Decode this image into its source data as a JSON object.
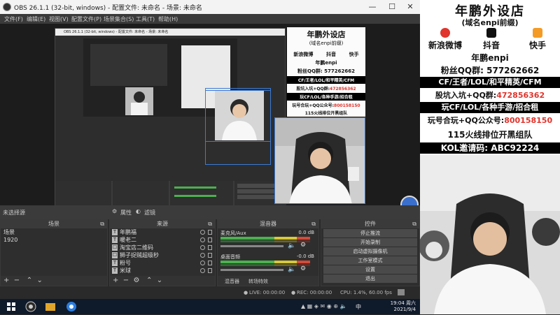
{
  "window": {
    "title": "OBS 26.1.1 (32-bit, windows) - 配置文件: 未命名 - 场景: 未命名",
    "minimize": "—",
    "maximize": "☐",
    "close": "✕"
  },
  "menu": [
    "文件(F)",
    "编辑(E)",
    "视图(V)",
    "配置文件(P)",
    "场景集合(S)",
    "工具(T)",
    "帮助(H)"
  ],
  "nested": {
    "title": "OBS 26.1.1 (32-bit, windows) - 配置文件: 未命名 - 场景: 未命名"
  },
  "info_panel": {
    "title": "年鹏外设店",
    "subtitle": "(域名enpi前缀)",
    "social": [
      "新浪微博",
      "抖音",
      "快手"
    ],
    "author": "年鹏enpi",
    "fans_qq": "粉丝QQ群: 577262662",
    "cf_line": "CF/王者/LOL/和平精英/CFM",
    "group_line_prefix": "股坑入坑+QQ群:",
    "group_num": "472856362",
    "games_line": "玩CF/LOL/各种手游/招合租",
    "wechat_prefix": "玩号合玩+QQ公众号:",
    "wechat_num": "800158150",
    "rank_line": "115火线排位开黑组队",
    "kol_line": "KOL邀请码: ABC92224"
  },
  "context_bar": {
    "no_source": "未选择源",
    "properties": "属性",
    "filters": "滤镜"
  },
  "docks": {
    "scenes": {
      "title": "场景",
      "items": [
        "场景",
        "1920"
      ]
    },
    "sources": {
      "title": "来源",
      "items": [
        {
          "icon": "T",
          "label": "年鹏福"
        },
        {
          "icon": "T",
          "label": "暖老二"
        },
        {
          "icon": "☐",
          "label": "淘宝店二维码"
        },
        {
          "icon": "☐",
          "label": "狮子捉贼超级秒"
        },
        {
          "icon": "T",
          "label": "粉号"
        },
        {
          "icon": "T",
          "label": "米球"
        }
      ]
    },
    "mixer": {
      "title": "混音器",
      "channels": [
        {
          "name": "麦克风/Aux",
          "db": "0.0 dB"
        },
        {
          "name": "桌面音频",
          "db": "-0.0 dB"
        }
      ],
      "tabs": [
        "混音器",
        "转场特效"
      ]
    },
    "controls": {
      "title": "控件",
      "buttons": [
        "停止推流",
        "开始录制",
        "启动虚拟摄像机",
        "工作室模式",
        "设置",
        "退出"
      ]
    }
  },
  "statusbar": {
    "live": "LIVE: 00:00:00",
    "rec": "REC: 00:00:00",
    "cpu": "CPU: 1.4%, 60.00 fps"
  },
  "taskbar": {
    "time": "19:04 周六",
    "date": "2021/9/4",
    "lang": "中"
  },
  "colors": {
    "accent_blue": "#3c7bd6",
    "red": "#e0342c",
    "meter_green": "#4caf50"
  }
}
